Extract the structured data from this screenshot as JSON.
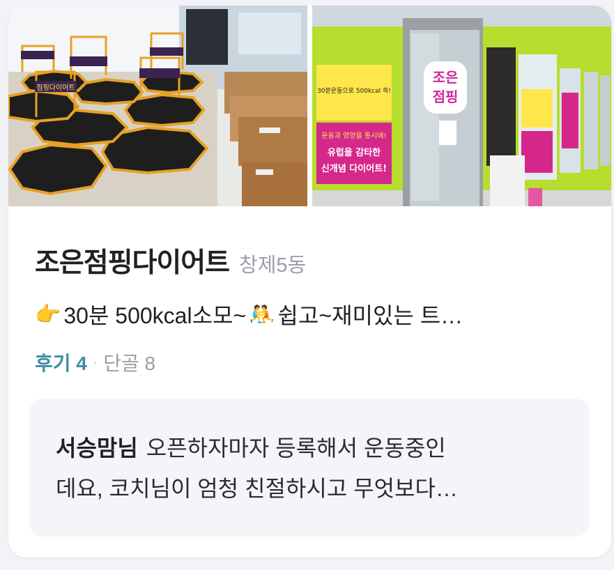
{
  "shop": {
    "name": "조은점핑다이어트",
    "region": "창제5동",
    "description": "30분 500kcal소모~ ",
    "description_tail": "쉽고~재미있는 트…",
    "emoji_point": "👉",
    "emoji_wrestlers": "🤼"
  },
  "stats": {
    "reviews_label": "후기 4",
    "separator": "·",
    "regulars_label": "단골 8"
  },
  "review": {
    "author": "서승맘님",
    "text_line1": "오픈하자마자 등록해서 운동중인",
    "text_line2": "데요, 코치님이 엄청 친절하시고 무엇보다…"
  },
  "photos": {
    "left_banner": "점핑다이어트",
    "right_sign_line1": "조은",
    "right_sign_line2": "점핑",
    "poster_line1": "운동과 영양을 통시에!",
    "poster_line2": "유럽을 감타한",
    "poster_line3": "신개념 다이어트!",
    "poster_top": "30분운동으로 500kcal 쏙!"
  },
  "colors": {
    "accent": "#3f8ea3",
    "title": "#212124",
    "muted": "#9a9ea6",
    "review_bg": "#f4f5f8"
  }
}
